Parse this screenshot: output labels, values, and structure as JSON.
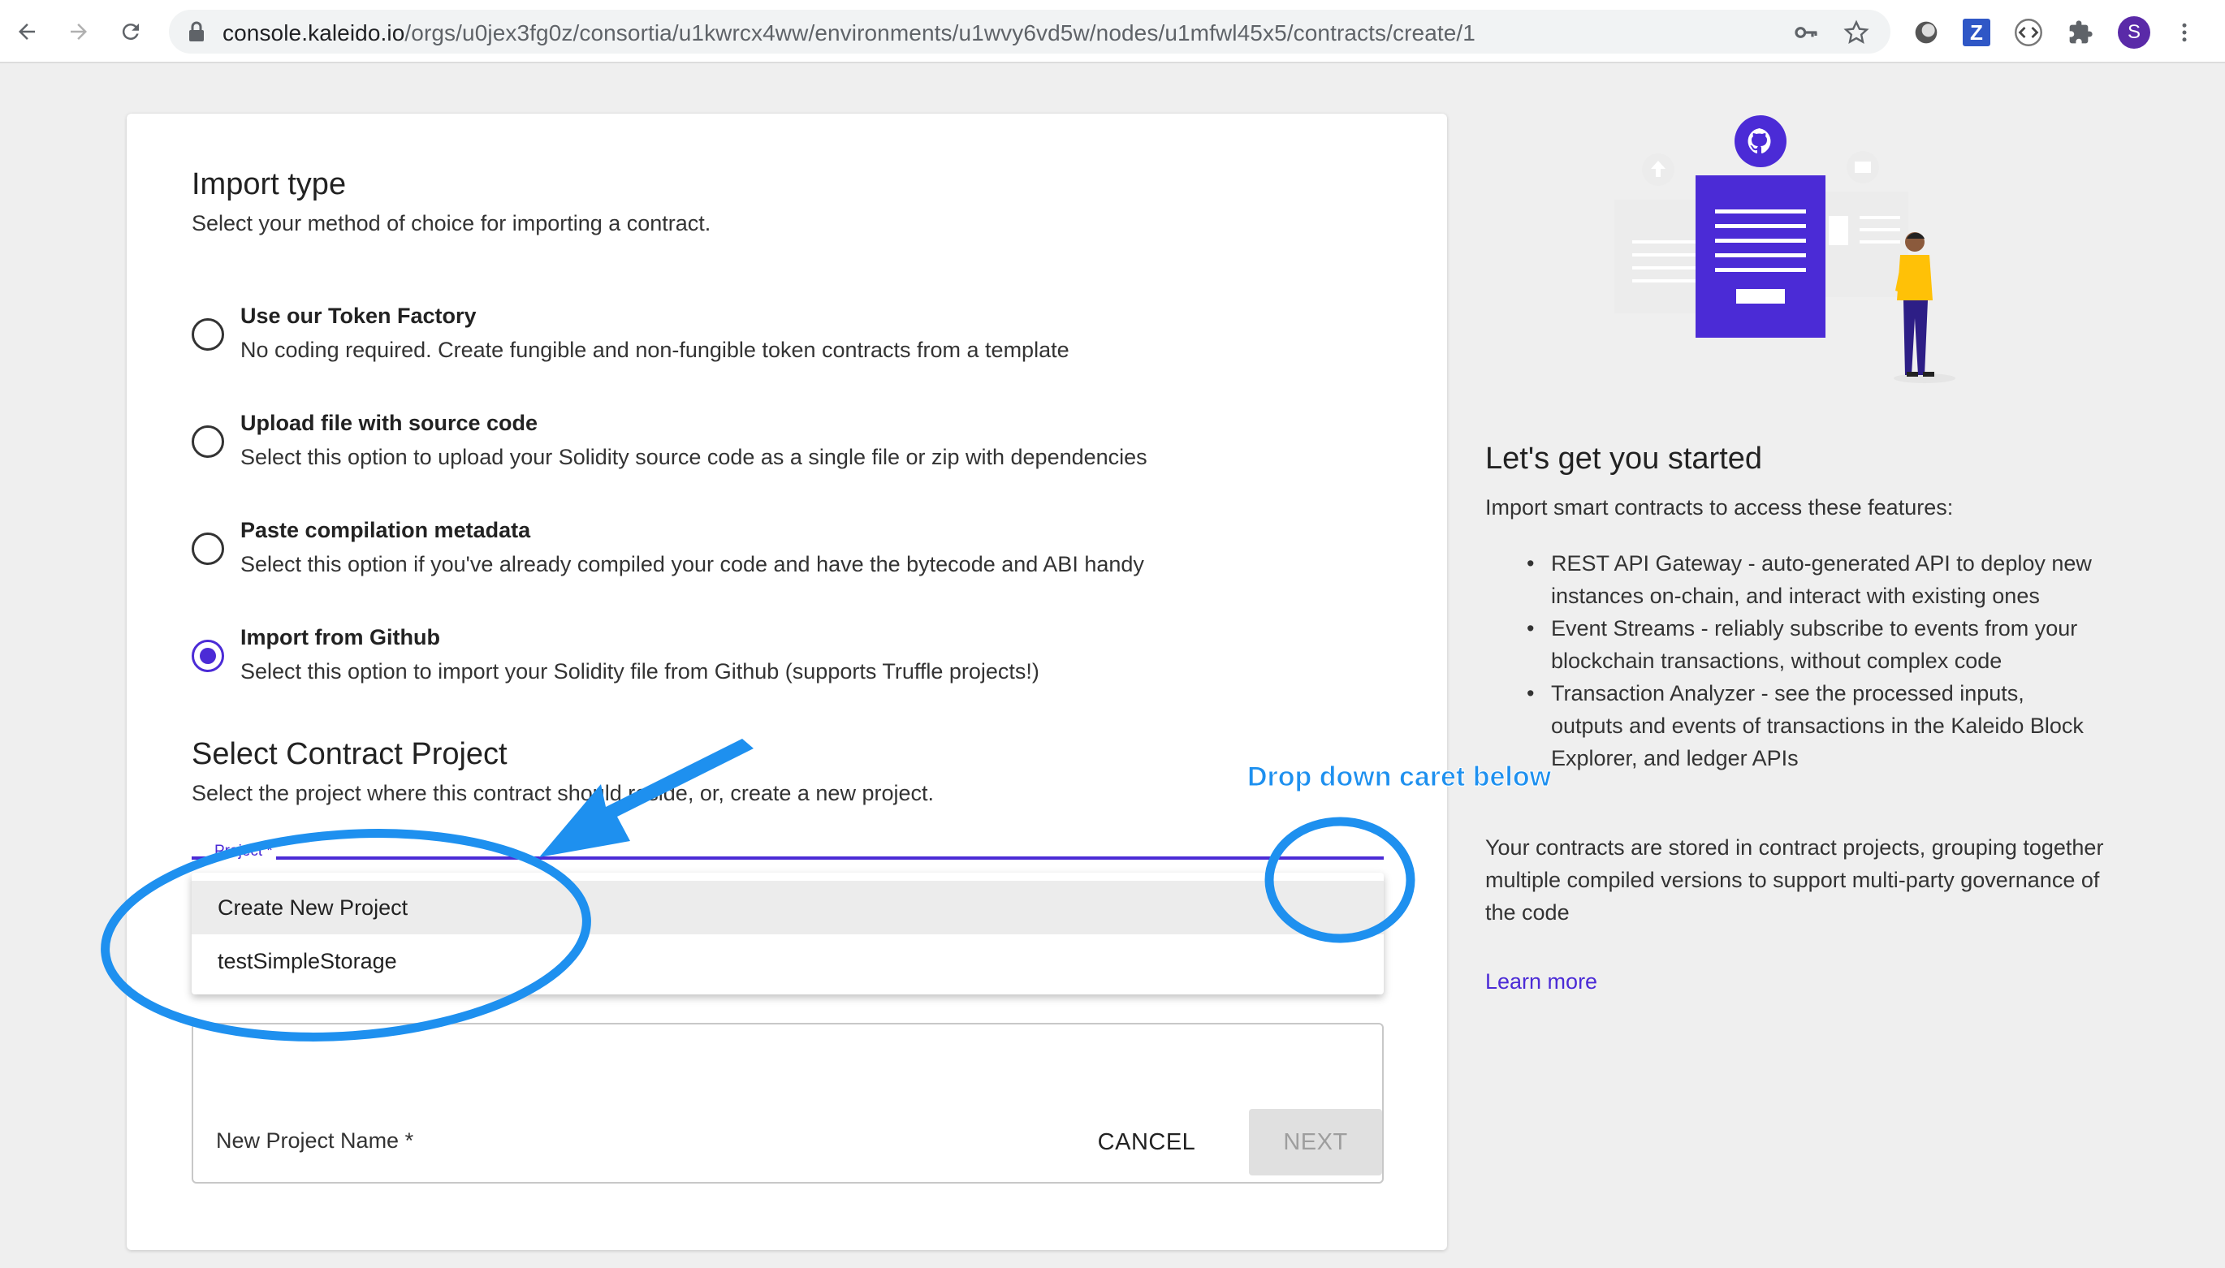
{
  "browser": {
    "url_host": "console.kaleido.io",
    "url_path": "/orgs/u0jex3fg0z/consortia/u1kwrcx4ww/environments/u1wvy6vd5w/nodes/u1mfwl45x5/contracts/create/1",
    "profile_initial": "S",
    "extension_z": "Z"
  },
  "import_type": {
    "title": "Import type",
    "subtitle": "Select your method of choice for importing a contract.",
    "options": [
      {
        "title": "Use our Token Factory",
        "desc": "No coding required. Create fungible and non-fungible token contracts from a template",
        "selected": false
      },
      {
        "title": "Upload file with source code",
        "desc": "Select this option to upload your Solidity source code as a single file or zip with dependencies",
        "selected": false
      },
      {
        "title": "Paste compilation metadata",
        "desc": "Select this option if you've already compiled your code and have the bytecode and ABI handy",
        "selected": false
      },
      {
        "title": "Import from Github",
        "desc": "Select this option to import your Solidity file from Github (supports Truffle projects!)",
        "selected": true
      }
    ]
  },
  "contract_project": {
    "title": "Select Contract Project",
    "subtitle": "Select the project where this contract should reside, or, create a new project.",
    "select_label": "Project *",
    "dropdown_items": [
      "Create New Project",
      "testSimpleStorage"
    ],
    "new_project_label": "New Project Name *"
  },
  "buttons": {
    "cancel": "CANCEL",
    "next": "NEXT"
  },
  "right_panel": {
    "title": "Let's get you started",
    "intro": "Import smart contracts to access these features:",
    "bullets": [
      "REST API Gateway - auto-generated API to deploy new instances on-chain, and interact with existing ones",
      "Event Streams - reliably subscribe to events from your blockchain transactions, without complex code",
      "Transaction Analyzer - see the processed inputs, outputs and events of transactions in the Kaleido Block Explorer, and ledger APIs"
    ],
    "paragraph": "Your contracts are stored in contract projects, grouping together multiple compiled versions to support multi-party governance of the code",
    "learn_more": "Learn more"
  },
  "annotation": {
    "text": "Drop down caret below"
  },
  "colors": {
    "accent": "#4b2bd6",
    "annotation": "#1e90ef"
  }
}
